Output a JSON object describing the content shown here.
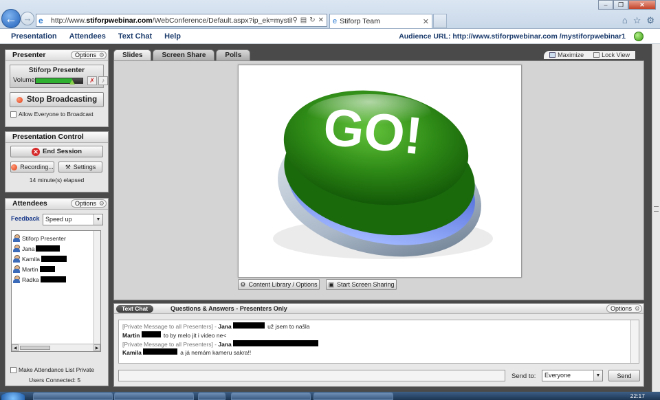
{
  "browser": {
    "url_prefix": "http://www.",
    "url_domain": "stiforpwebinar.com",
    "url_rest": "/WebConference/Default.aspx?ip_ek=mystiforpwebin",
    "tab_title": "Stiforp Team"
  },
  "menu": {
    "items": [
      "Presentation",
      "Attendees",
      "Text Chat",
      "Help"
    ],
    "audience_url": "Audience URL: http://www.stiforpwebinar.com /mystiforpwebinar1"
  },
  "presenter": {
    "title": "Presenter",
    "options_label": "Options",
    "name": "Stiforp Presenter",
    "volume_label": "Volume:",
    "volume_level": 0.78,
    "stop_label": "Stop Broadcasting",
    "allow_label": "Allow Everyone to Broadcast"
  },
  "control": {
    "title": "Presentation Control",
    "end_label": "End Session",
    "recording_label": "Recording...",
    "settings_label": "Settings",
    "elapsed": "14 minute(s) elapsed"
  },
  "attendees": {
    "title": "Attendees",
    "options_label": "Options",
    "feedback_label": "Feedback",
    "feedback_value": "Speed up",
    "list": [
      {
        "name": "Stiforp Presenter",
        "redacted": false
      },
      {
        "name": "Jana",
        "redacted": true
      },
      {
        "name": "Kamila",
        "redacted": true
      },
      {
        "name": "Martin",
        "redacted": true
      },
      {
        "name": "Radka",
        "redacted": true
      }
    ],
    "private_label": "Make Attendance List Private",
    "connected": "Users Connected: 5"
  },
  "stage": {
    "tabs": [
      "Slides",
      "Screen Share",
      "Polls"
    ],
    "maximize_label": "Maximize",
    "lockview_label": "Lock View",
    "slide_text": "GO!",
    "content_library_label": "Content Library / Options",
    "screen_share_label": "Start Screen Sharing"
  },
  "chat": {
    "tab_text_chat": "Text Chat",
    "tab_qa": "Questions & Answers - Presenters Only",
    "options_label": "Options",
    "messages": [
      {
        "meta": "[Private Message to all Presenters] - ",
        "sender": "Jana",
        "text": " už jsem to našla"
      },
      {
        "meta": "",
        "sender": "Martin",
        "text": " to by melo jit i video ne<"
      },
      {
        "meta": "[Private Message to all Presenters] - ",
        "sender": "Jana",
        "text": ""
      },
      {
        "meta": "",
        "sender": "Kamila",
        "text": " a já nemám kameru sakra!!"
      }
    ],
    "send_to_label": "Send to:",
    "send_to_value": "Everyone",
    "send_label": "Send"
  },
  "taskbar": {
    "time": "22:17"
  }
}
